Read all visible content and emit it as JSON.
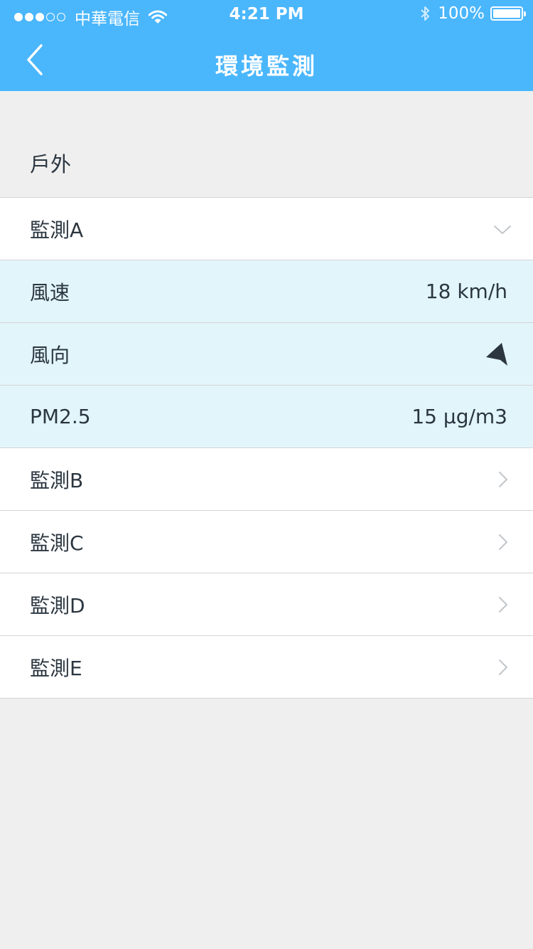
{
  "status_bar": {
    "carrier": "中華電信",
    "time": "4:21 PM",
    "battery": "100%",
    "signal_bars_filled": 3,
    "signal_bars_total": 5,
    "icons": [
      "wifi-icon",
      "bluetooth-icon",
      "battery-icon"
    ]
  },
  "nav": {
    "title": "環境監測",
    "back_icon": "chevron-left-icon"
  },
  "section": {
    "header": "戶外"
  },
  "monitors": [
    {
      "label": "監測A",
      "expanded": true,
      "icon": "chevron-down-icon"
    },
    {
      "label": "監測B",
      "expanded": false,
      "icon": "chevron-right-icon"
    },
    {
      "label": "監測C",
      "expanded": false,
      "icon": "chevron-right-icon"
    },
    {
      "label": "監測D",
      "expanded": false,
      "icon": "chevron-right-icon"
    },
    {
      "label": "監測E",
      "expanded": false,
      "icon": "chevron-right-icon"
    }
  ],
  "details": {
    "wind_speed": {
      "label": "風速",
      "value": "18 km/h"
    },
    "wind_direction": {
      "label": "風向",
      "icon": "direction-arrow-icon"
    },
    "pm25": {
      "label": "PM2.5",
      "value": "15 µg/m3"
    }
  },
  "colors": {
    "accent": "#4ab6fc",
    "detail_bg": "#e2f5fb",
    "page_bg": "#efefef",
    "text": "#2b3640"
  }
}
